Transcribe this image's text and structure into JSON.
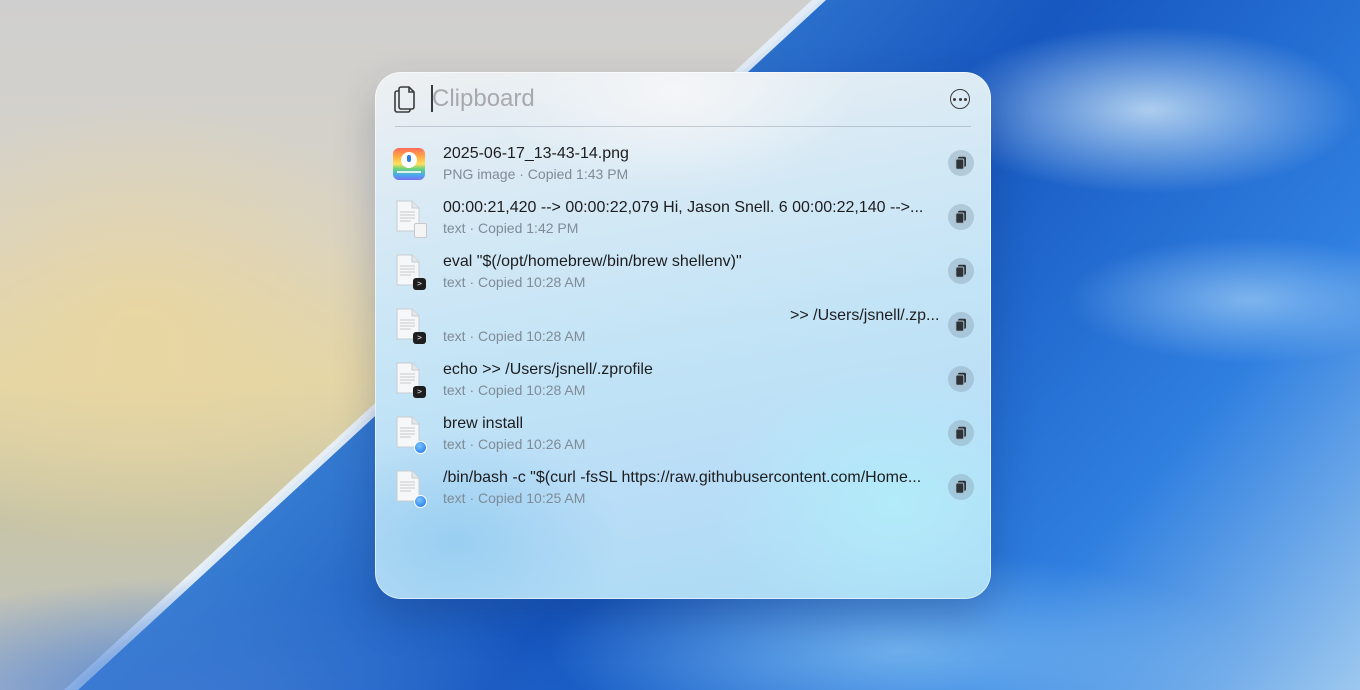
{
  "search": {
    "placeholder": "Clipboard"
  },
  "items": [
    {
      "title": "2025-06-17_13-43-14.png",
      "subtitle": "PNG image · Copied 1:43 PM",
      "thumb": "png-image",
      "badge": ""
    },
    {
      "title": " 00:00:21,420 --> 00:00:22,079 Hi, Jason Snell. 6 00:00:22,140 -->...",
      "subtitle": "text · Copied 1:42 PM",
      "thumb": "text-document",
      "badge": "document-icon"
    },
    {
      "title": "eval \"$(/opt/homebrew/bin/brew shellenv)\"",
      "subtitle": "text · Copied 10:28 AM",
      "thumb": "text-document",
      "badge": "terminal-icon"
    },
    {
      "title": ">> /Users/jsnell/.zp...",
      "subtitle": "text · Copied 10:28 AM",
      "thumb": "text-document",
      "badge": "terminal-icon"
    },
    {
      "title": "echo >> /Users/jsnell/.zprofile",
      "subtitle": "text · Copied 10:28 AM",
      "thumb": "text-document",
      "badge": "terminal-icon"
    },
    {
      "title": "brew install",
      "subtitle": "text · Copied 10:26 AM",
      "thumb": "text-document",
      "badge": "safari-icon"
    },
    {
      "title": "/bin/bash -c \"$(curl -fsSL https://raw.githubusercontent.com/Home...",
      "subtitle": "text · Copied 10:25 AM",
      "thumb": "text-document",
      "badge": "safari-icon"
    }
  ],
  "icons": {
    "header": "clipboard-icon",
    "more": "more-options-icon",
    "copy": "copy-icon"
  },
  "colors": {
    "panel_tint": "#c3e4f6",
    "placeholder": "#a7a9ad",
    "title_text": "#1d1d1f",
    "subtitle_text": "#7f8b96"
  }
}
